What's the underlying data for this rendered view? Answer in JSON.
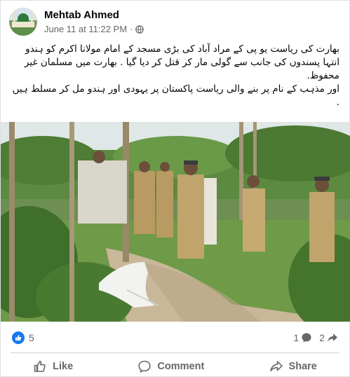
{
  "post": {
    "author": "Mehtab Ahmed",
    "timestamp": "June 11 at 11:22 PM",
    "separator": "·",
    "privacy_icon": "globe-icon",
    "text_lines": [
      "بھارت کی ریاست یو پی کے مراد آباد کی بڑی مسجد کے امام مولانا اکرم کو ہندو انتہا پسندوں کی جانب سے گولی مار کر قتل کر دیا گیا . بھارت میں مسلمان غیر محفوظ.",
      "اور مذہب کے نام پر بنے والی ریاست پاکستان پر یہودی اور ہندو مل کر مسلط ہیں ."
    ]
  },
  "stats": {
    "reaction_icon": "like-icon",
    "reaction_count": "5",
    "comment_count": "1",
    "share_count": "2"
  },
  "actions": {
    "like": "Like",
    "comment": "Comment",
    "share": "Share"
  },
  "colors": {
    "accent": "#1877f2",
    "secondary_text": "#65676b",
    "primary_text": "#050505",
    "divider": "#ced0d4"
  }
}
